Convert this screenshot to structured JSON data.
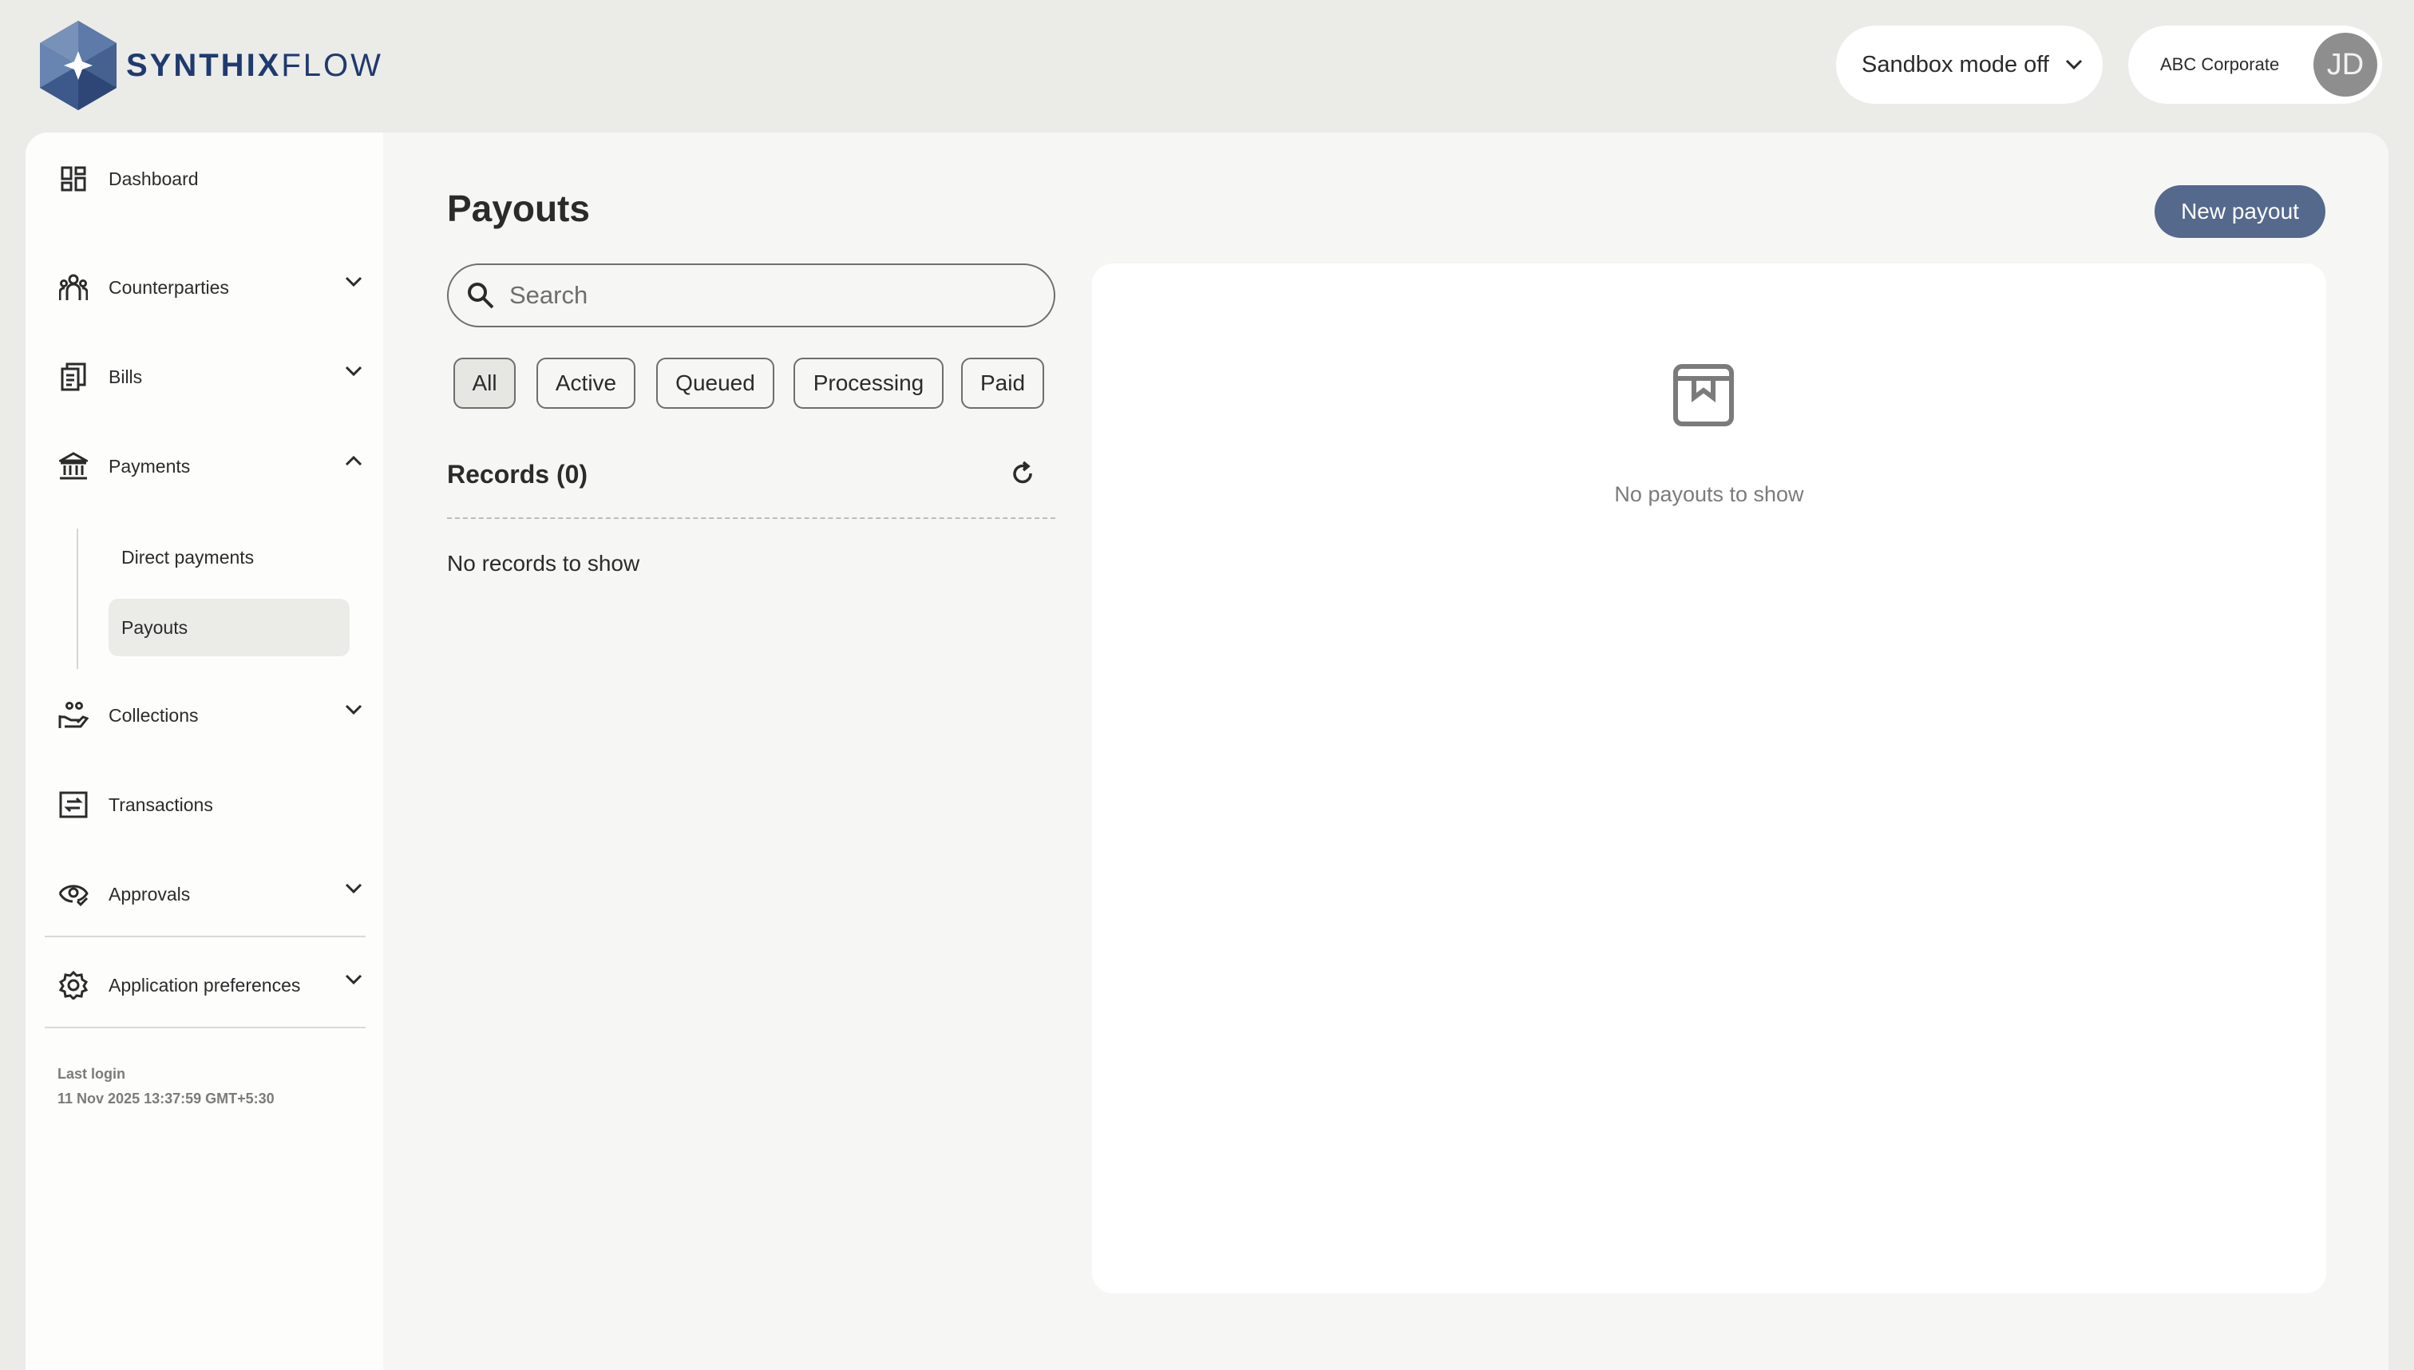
{
  "brand": {
    "name_bold": "SYNTHIX",
    "name_light": "FLOW",
    "logo_icon": "hexagon-snowflake-logo"
  },
  "header": {
    "sandbox_label": "Sandbox mode off",
    "company": "ABC Corporate",
    "avatar_initials": "JD"
  },
  "sidebar": {
    "items": [
      {
        "label": "Dashboard",
        "icon": "dashboard-icon"
      },
      {
        "label": "Counterparties",
        "icon": "people-icon",
        "expandable": true
      },
      {
        "label": "Bills",
        "icon": "bills-icon",
        "expandable": true
      },
      {
        "label": "Payments",
        "icon": "bank-icon",
        "expandable": true,
        "expanded": true
      },
      {
        "label": "Collections",
        "icon": "collections-icon",
        "expandable": true
      },
      {
        "label": "Transactions",
        "icon": "transactions-icon"
      },
      {
        "label": "Approvals",
        "icon": "eye-icon",
        "expandable": true
      },
      {
        "label": "Application preferences",
        "icon": "gear-icon",
        "expandable": true
      }
    ],
    "payments_sub": [
      {
        "label": "Direct payments",
        "active": false
      },
      {
        "label": "Payouts",
        "active": true
      }
    ],
    "last_login_label": "Last login",
    "last_login_value": "11 Nov 2025 13:37:59 GMT+5:30"
  },
  "main": {
    "title": "Payouts",
    "new_button": "New payout",
    "search_placeholder": "Search",
    "filters": [
      "All",
      "Active",
      "Queued",
      "Processing",
      "Paid"
    ],
    "selected_filter": "All",
    "records_title": "Records (0)",
    "no_records": "No records to show",
    "empty_detail": "No payouts to show"
  },
  "colors": {
    "primary": "#55698c",
    "brand": "#1f3a6e",
    "background": "#ebebe8"
  }
}
